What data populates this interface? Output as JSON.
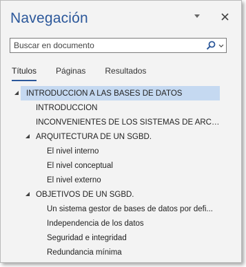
{
  "header": {
    "title": "Navegación",
    "dropdown_icon": "triangle-down-icon",
    "close_icon": "close-icon"
  },
  "search": {
    "placeholder": "Buscar en documento",
    "value": "",
    "search_icon": "magnifier-icon",
    "options_icon": "chevron-down-icon"
  },
  "tabs": [
    {
      "label": "Títulos",
      "active": true
    },
    {
      "label": "Páginas",
      "active": false
    },
    {
      "label": "Resultados",
      "active": false
    }
  ],
  "tree": [
    {
      "label": "INTRODUCCIÓN A LAS BASES DE DATOS",
      "level": 0,
      "expanded": true,
      "selected": true
    },
    {
      "label": "INTRODUCCIÓN",
      "level": 1,
      "expanded": null,
      "selected": false
    },
    {
      "label": "INCONVENIENTES DE LOS SISTEMAS DE ARCHIV...",
      "level": 1,
      "expanded": null,
      "selected": false
    },
    {
      "label": "ARQUITECTURA DE UN SGBD.",
      "level": 1,
      "expanded": true,
      "selected": false
    },
    {
      "label": "El nivel interno",
      "level": 2,
      "expanded": null,
      "selected": false
    },
    {
      "label": "El nivel conceptual",
      "level": 2,
      "expanded": null,
      "selected": false
    },
    {
      "label": "El nivel externo",
      "level": 2,
      "expanded": null,
      "selected": false
    },
    {
      "label": "OBJETIVOS DE UN SGBD.",
      "level": 1,
      "expanded": true,
      "selected": false
    },
    {
      "label": "Un sistema gestor de bases de datos por defi...",
      "level": 2,
      "expanded": null,
      "selected": false
    },
    {
      "label": "Independencia de los datos",
      "level": 2,
      "expanded": null,
      "selected": false
    },
    {
      "label": "Seguridad e integridad",
      "level": 2,
      "expanded": null,
      "selected": false
    },
    {
      "label": "Redundancia mínima",
      "level": 2,
      "expanded": null,
      "selected": false
    }
  ],
  "colors": {
    "accent": "#2b579a",
    "selection": "#c5d9f1",
    "pane_bg": "#f3f3f3"
  }
}
